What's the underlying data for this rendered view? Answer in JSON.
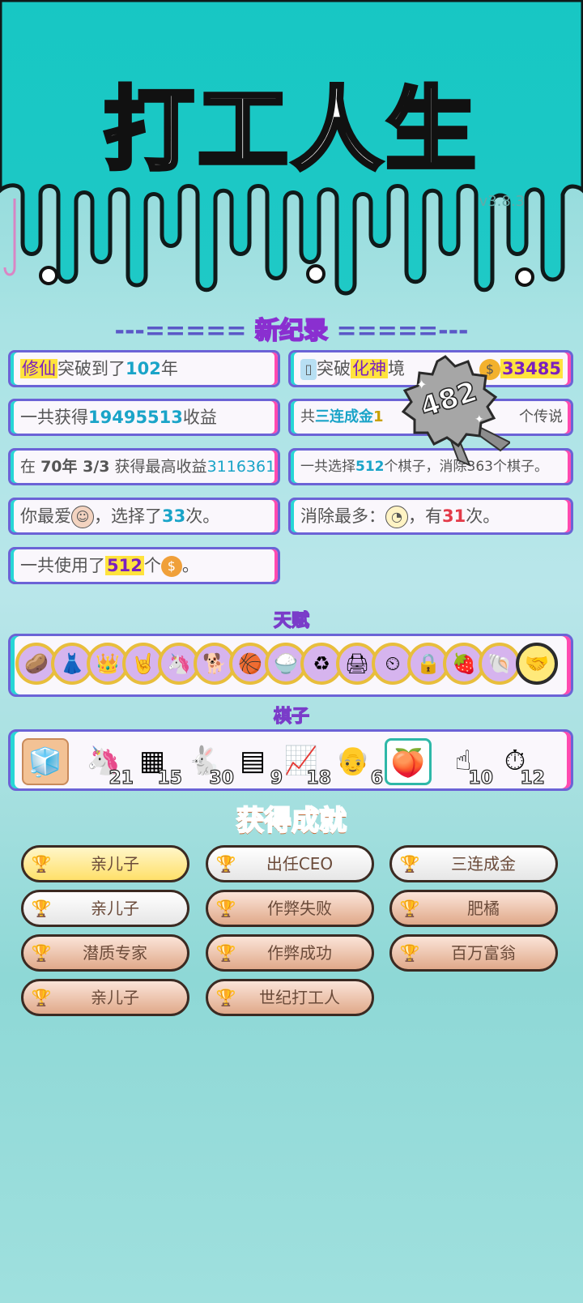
{
  "app": {
    "title": "打工人生",
    "version": "v3.8.3"
  },
  "records": {
    "header_left": "---=====",
    "header_word": "新纪录",
    "header_right": "=====---",
    "items": [
      {
        "pre": "",
        "hl": "修仙",
        "mid": "突破到了",
        "num": "102",
        "post": "年"
      },
      {
        "pre": "",
        "hl": "化神",
        "mid": "突破",
        "num": "33485",
        "post": "境"
      },
      {
        "pre": "一共获得",
        "hl": "",
        "mid": "",
        "num": "19495513",
        "post": "收益"
      },
      {
        "pre": "共",
        "hl": "三连成金",
        "mid": "1",
        "num": "",
        "post": "个传说"
      },
      {
        "pre": "在",
        "hl": "70年 3/3",
        "mid": "获得最高收益",
        "num": "3116361",
        "post": ""
      },
      {
        "pre": "一共选择",
        "hl": "",
        "mid": "512",
        "num": "363",
        "post": "个棋子，消除363个棋子。"
      },
      {
        "pre": "你最爱",
        "hl": "",
        "mid": "，选择了",
        "num": "33",
        "post": "次。"
      },
      {
        "pre": "消除最多：",
        "hl": "",
        "mid": "，有",
        "num": "31",
        "post": "次。"
      },
      {
        "pre": "一共使用了",
        "hl": "",
        "mid": "",
        "num": "512",
        "post": "个"
      }
    ],
    "badge_number": "482"
  },
  "talents": {
    "label": "天赋",
    "icons": [
      "potato-icon",
      "skirt-icon",
      "crown-icon",
      "rock-hand-icon",
      "unicorn-icon",
      "dog-icon",
      "basketball-icon",
      "rice-bag-icon",
      "recycle-icon",
      "printer-icon",
      "time-clock-icon",
      "safe-icon",
      "fruit-icon",
      "shell-icon",
      "handshake-icon"
    ]
  },
  "pieces": {
    "label": "棋子",
    "items": [
      {
        "icon": "fridge-icon",
        "count": ""
      },
      {
        "icon": "unicorn-icon",
        "count": "21"
      },
      {
        "icon": "gold-bars-icon",
        "count": "15"
      },
      {
        "icon": "rabbit-icon",
        "count": "30"
      },
      {
        "icon": "gpu-icon",
        "count": "9"
      },
      {
        "icon": "stock-chart-icon",
        "count": "18"
      },
      {
        "icon": "old-man-icon",
        "count": "6"
      },
      {
        "icon": "peach-icon",
        "count": ""
      },
      {
        "icon": "pointer-hand-icon",
        "count": "10"
      },
      {
        "icon": "timer-icon",
        "count": "12"
      }
    ]
  },
  "achievements": {
    "label": "获得成就",
    "items": [
      {
        "label": "亲儿子",
        "tier": "gold"
      },
      {
        "label": "出任CEO",
        "tier": "silver"
      },
      {
        "label": "三连成金",
        "tier": "silver"
      },
      {
        "label": "亲儿子",
        "tier": "silver"
      },
      {
        "label": "作弊失败",
        "tier": "bronze"
      },
      {
        "label": "肥橘",
        "tier": "bronze"
      },
      {
        "label": "潜质专家",
        "tier": "bronze"
      },
      {
        "label": "作弊成功",
        "tier": "bronze"
      },
      {
        "label": "百万富翁",
        "tier": "bronze"
      },
      {
        "label": "亲儿子",
        "tier": "bronze"
      },
      {
        "label": "世纪打工人",
        "tier": "bronze"
      }
    ]
  },
  "colors": {
    "accent": "#6b63d6",
    "pink": "#ff4ab0",
    "cyan": "#27d6d6",
    "teal": "#17c7c4"
  }
}
